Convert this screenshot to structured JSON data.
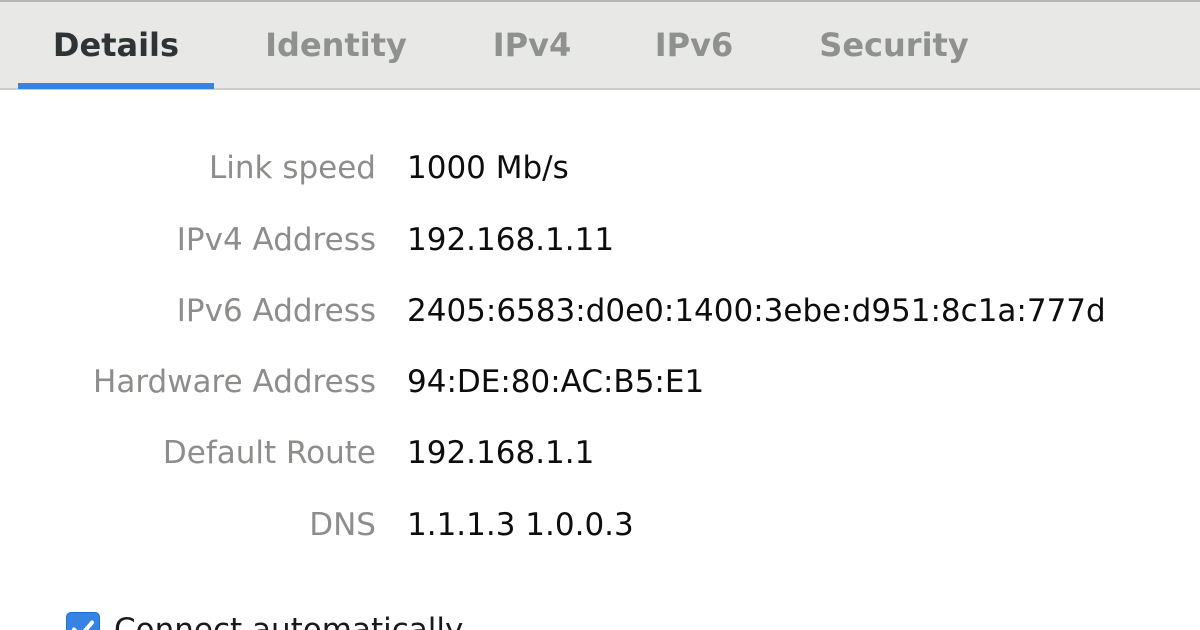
{
  "tabs": [
    {
      "label": "Details",
      "active": true
    },
    {
      "label": "Identity",
      "active": false
    },
    {
      "label": "IPv4",
      "active": false
    },
    {
      "label": "IPv6",
      "active": false
    },
    {
      "label": "Security",
      "active": false
    }
  ],
  "details": [
    {
      "label": "Link speed",
      "value": "1000 Mb/s"
    },
    {
      "label": "IPv4 Address",
      "value": "192.168.1.11"
    },
    {
      "label": "IPv6 Address",
      "value": "2405:6583:d0e0:1400:3ebe:d951:8c1a:777d"
    },
    {
      "label": "Hardware Address",
      "value": "94:DE:80:AC:B5:E1"
    },
    {
      "label": "Default Route",
      "value": "192.168.1.1"
    },
    {
      "label": "DNS",
      "value": "1.1.1.3 1.0.0.3"
    }
  ],
  "connect_automatically": {
    "label": "Connect automatically",
    "checked": true,
    "icon": "checkmark-icon"
  },
  "colors": {
    "accent": "#3584e4",
    "tabbar_bg": "#e8e8e7",
    "label_text": "#8c8e8c",
    "value_text": "#0d0d0d"
  }
}
